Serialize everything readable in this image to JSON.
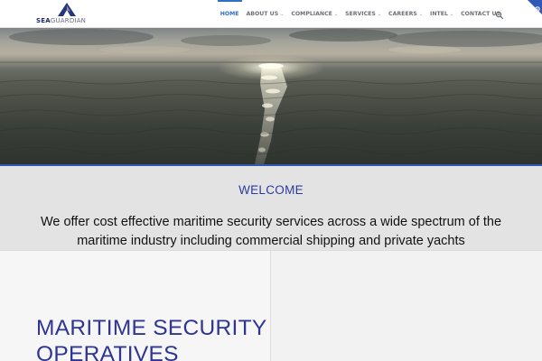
{
  "header": {
    "logo": {
      "part1": "SEA",
      "part2": "GUARDIAN"
    },
    "nav": [
      {
        "label": "HOME",
        "active": true,
        "dropdown": false
      },
      {
        "label": "ABOUT US",
        "active": false,
        "dropdown": true
      },
      {
        "label": "COMPLIANCE",
        "active": false,
        "dropdown": true
      },
      {
        "label": "SERVICES",
        "active": false,
        "dropdown": true
      },
      {
        "label": "CAREERS",
        "active": false,
        "dropdown": true
      },
      {
        "label": "INTEL",
        "active": false,
        "dropdown": true
      },
      {
        "label": "CONTACT US",
        "active": false,
        "dropdown": false
      }
    ],
    "search_icon": "search-icon",
    "corner_icon": "gear-icon"
  },
  "hero": {
    "image": "ocean-sunset-photo"
  },
  "welcome": {
    "title": "WELCOME",
    "text": "We offer cost effective maritime security services across a wide spectrum of the maritime industry including commercial shipping and private yachts"
  },
  "section": {
    "title_line1": "MARITIME SECURITY",
    "title_line2": "OPERATIVES"
  },
  "colors": {
    "brand": "#2f58b7",
    "heading": "#2f3592",
    "active_nav": "#2f6fc4"
  }
}
